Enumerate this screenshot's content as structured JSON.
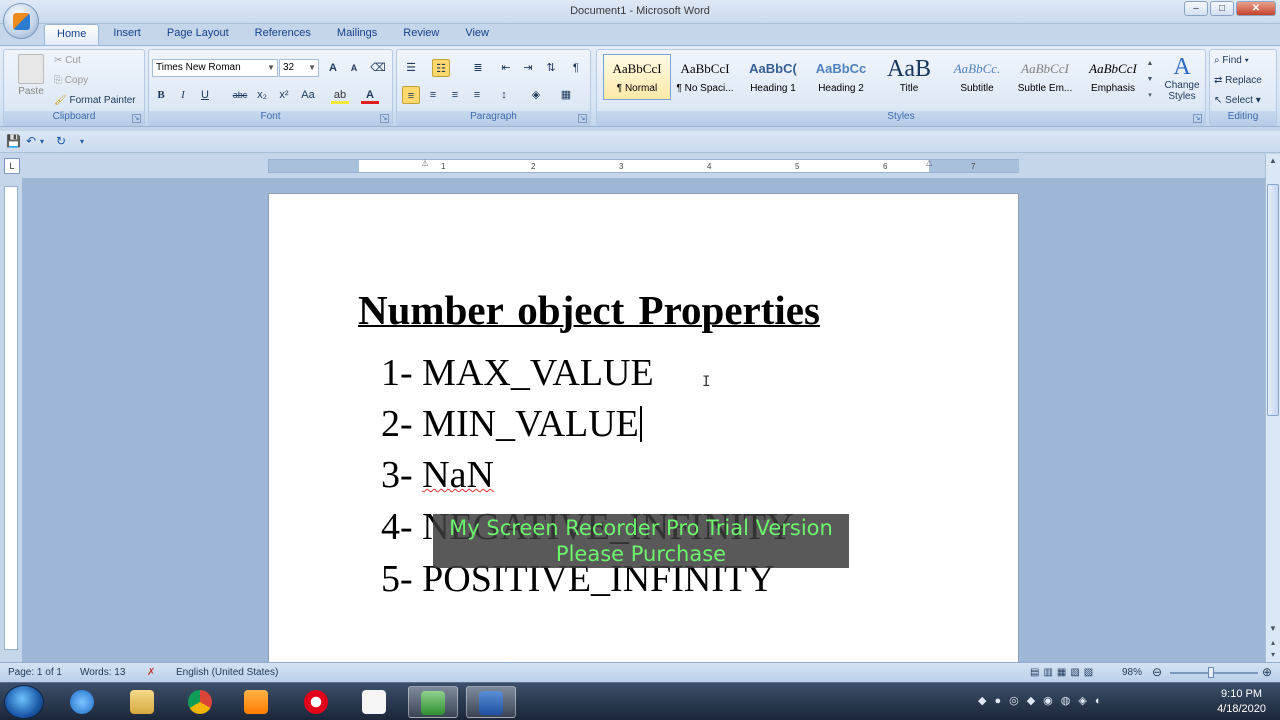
{
  "window": {
    "title": "Document1 - Microsoft Word",
    "min": "–",
    "max": "□",
    "close": "✕"
  },
  "tabs": [
    "Home",
    "Insert",
    "Page Layout",
    "References",
    "Mailings",
    "Review",
    "View"
  ],
  "clipboard": {
    "paste": "Paste",
    "cut": "Cut",
    "copy": "Copy",
    "format_painter": "Format Painter",
    "label": "Clipboard"
  },
  "font": {
    "name": "Times New Roman",
    "size": "32",
    "label": "Font",
    "bold": "B",
    "italic": "I",
    "underline": "U",
    "strike": "abc",
    "subscript": "x₂",
    "superscript": "x²",
    "change_case": "Aa",
    "grow": "A",
    "shrink": "A"
  },
  "paragraph": {
    "label": "Paragraph",
    "pilcrow": "¶"
  },
  "styles": {
    "label": "Styles",
    "items": [
      {
        "sample": "AaBbCcI",
        "name": "¶ Normal"
      },
      {
        "sample": "AaBbCcI",
        "name": "¶ No Spaci..."
      },
      {
        "sample": "AaBbC(",
        "name": "Heading 1"
      },
      {
        "sample": "AaBbCc",
        "name": "Heading 2"
      },
      {
        "sample": "AaB",
        "name": "Title"
      },
      {
        "sample": "AaBbCc.",
        "name": "Subtitle"
      },
      {
        "sample": "AaBbCcI",
        "name": "Subtle Em..."
      },
      {
        "sample": "AaBbCcI",
        "name": "Emphasis"
      }
    ],
    "change_styles": "Change Styles"
  },
  "editing": {
    "label": "Editing",
    "find": "Find",
    "replace": "Replace",
    "select": "Select"
  },
  "ruler": {
    "ticks": [
      "1",
      "1",
      "2",
      "3",
      "4",
      "5",
      "6",
      "7"
    ]
  },
  "document": {
    "title": "Number object Properties",
    "items": [
      {
        "num": "1- ",
        "text": "MAX_VALUE"
      },
      {
        "num": "2- ",
        "text": "MIN_VALUE"
      },
      {
        "num": "3- ",
        "text": "NaN"
      },
      {
        "num": "4- ",
        "text": "NEGATIVE_INFINITY"
      },
      {
        "num": "5- ",
        "text": "POSITIVE_INFINITY"
      }
    ]
  },
  "watermark": {
    "line1": "My Screen Recorder Pro Trial Version",
    "line2": "Please Purchase"
  },
  "status": {
    "page": "Page: 1 of 1",
    "words": "Words: 13",
    "language": "English (United States)",
    "zoom": "98%"
  },
  "taskbar": {
    "time": "9:10 PM",
    "date": "4/18/2020"
  }
}
